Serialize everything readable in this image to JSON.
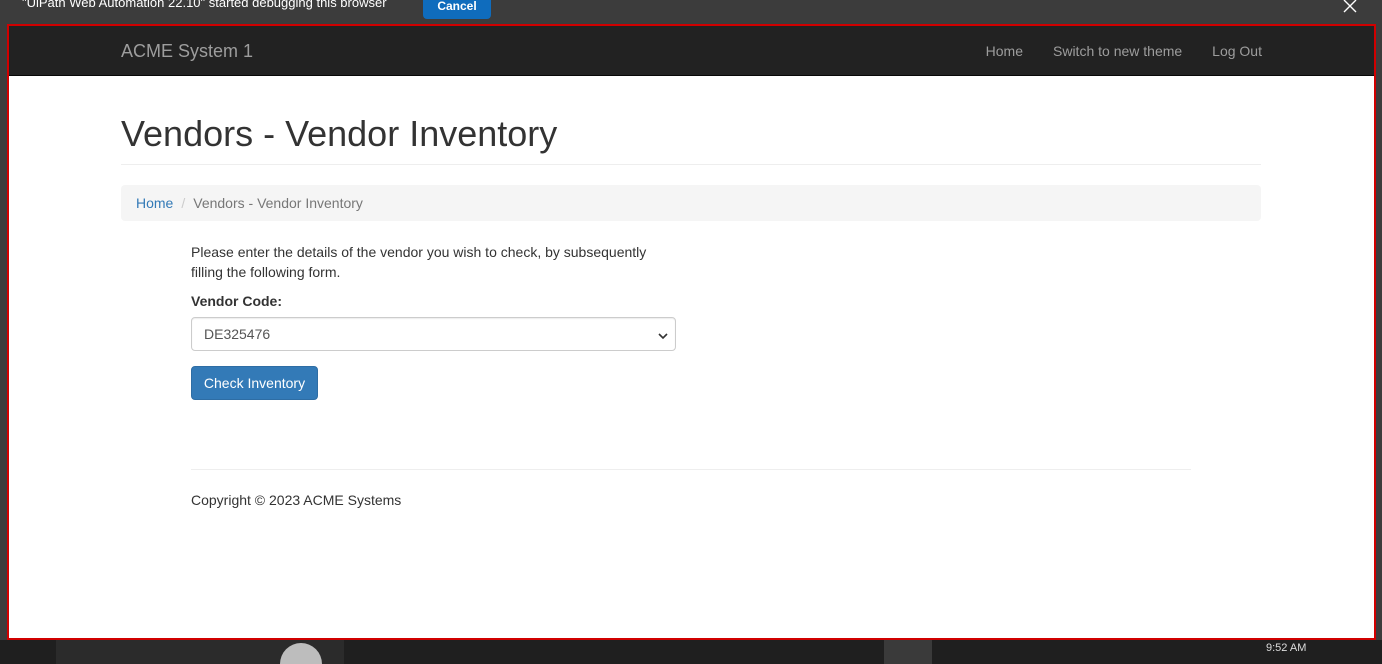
{
  "debug_bar": {
    "message": "\"UiPath Web Automation 22.10\" started debugging this browser",
    "cancel_label": "Cancel",
    "close_icon": "close-icon"
  },
  "navbar": {
    "brand": "ACME System 1",
    "links": [
      "Home",
      "Switch to new theme",
      "Log Out"
    ]
  },
  "page": {
    "title": "Vendors - Vendor Inventory"
  },
  "breadcrumb": {
    "home": "Home",
    "separator": "/",
    "current": "Vendors - Vendor Inventory"
  },
  "form": {
    "intro": "Please enter the details of the vendor you wish to check, by subsequently filling the following form.",
    "vendor_code_label": "Vendor Code:",
    "vendor_code_value": "DE325476",
    "submit_label": "Check Inventory"
  },
  "footer": {
    "copyright": "Copyright © 2023 ACME Systems"
  },
  "taskbar": {
    "clock": "9:52 AM"
  },
  "colors": {
    "accent": "#337ab7",
    "navbar_bg": "#222222",
    "debug_cancel": "#0f6cbd",
    "frame_outline": "#d10000"
  }
}
